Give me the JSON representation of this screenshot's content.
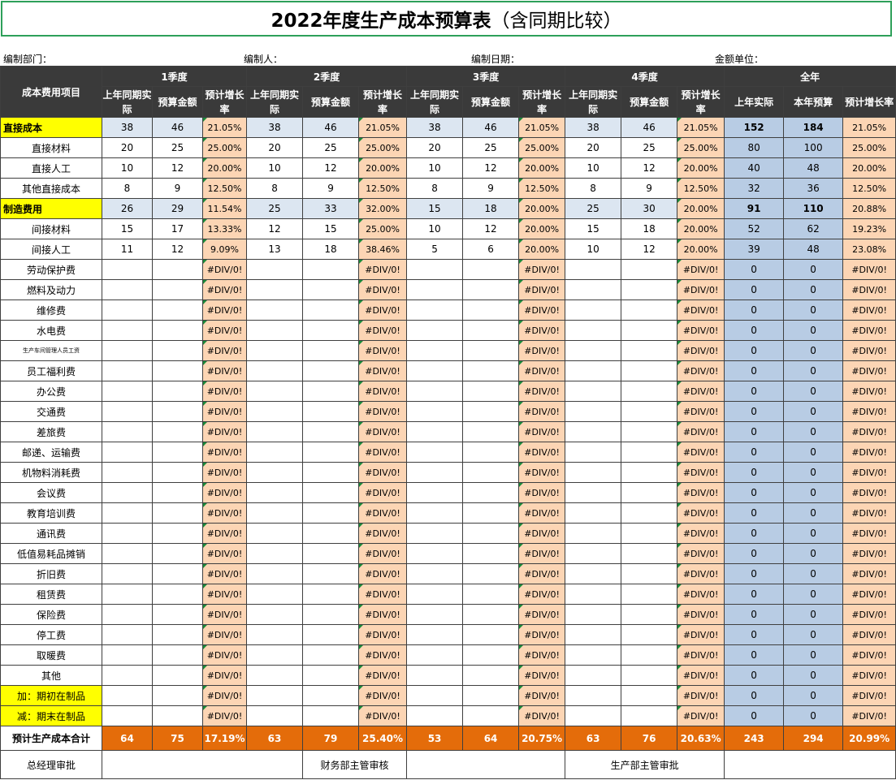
{
  "title": {
    "main": "2022年度生产成本预算表",
    "sub": "（含同期比较）"
  },
  "meta": {
    "dept": "编制部门：",
    "preparer": "编制人：",
    "date": "编制日期：",
    "unit": "金额单位："
  },
  "header": {
    "item": "成本费用项目",
    "quarters": [
      "1季度",
      "2季度",
      "3季度",
      "4季度"
    ],
    "year": "全年",
    "q_cols": [
      "上年同期实际",
      "预算金额",
      "预计增长率"
    ],
    "year_cols": [
      "上年实际",
      "本年预算",
      "预计增长率"
    ]
  },
  "rows": [
    {
      "label": "直接成本",
      "kind": "cat",
      "q": [
        [
          "38",
          "46",
          "21.05%"
        ],
        [
          "38",
          "46",
          "21.05%"
        ],
        [
          "38",
          "46",
          "21.05%"
        ],
        [
          "38",
          "46",
          "21.05%"
        ]
      ],
      "y": [
        "152",
        "184",
        "21.05%"
      ]
    },
    {
      "label": "直接材料",
      "kind": "item",
      "q": [
        [
          "20",
          "25",
          "25.00%"
        ],
        [
          "20",
          "25",
          "25.00%"
        ],
        [
          "20",
          "25",
          "25.00%"
        ],
        [
          "20",
          "25",
          "25.00%"
        ]
      ],
      "y": [
        "80",
        "100",
        "25.00%"
      ]
    },
    {
      "label": "直接人工",
      "kind": "item",
      "q": [
        [
          "10",
          "12",
          "20.00%"
        ],
        [
          "10",
          "12",
          "20.00%"
        ],
        [
          "10",
          "12",
          "20.00%"
        ],
        [
          "10",
          "12",
          "20.00%"
        ]
      ],
      "y": [
        "40",
        "48",
        "20.00%"
      ]
    },
    {
      "label": "其他直接成本",
      "kind": "item",
      "q": [
        [
          "8",
          "9",
          "12.50%"
        ],
        [
          "8",
          "9",
          "12.50%"
        ],
        [
          "8",
          "9",
          "12.50%"
        ],
        [
          "8",
          "9",
          "12.50%"
        ]
      ],
      "y": [
        "32",
        "36",
        "12.50%"
      ]
    },
    {
      "label": "制造费用",
      "kind": "cat",
      "q": [
        [
          "26",
          "29",
          "11.54%"
        ],
        [
          "25",
          "33",
          "32.00%"
        ],
        [
          "15",
          "18",
          "20.00%"
        ],
        [
          "25",
          "30",
          "20.00%"
        ]
      ],
      "y": [
        "91",
        "110",
        "20.88%"
      ]
    },
    {
      "label": "间接材料",
      "kind": "item",
      "q": [
        [
          "15",
          "17",
          "13.33%"
        ],
        [
          "12",
          "15",
          "25.00%"
        ],
        [
          "10",
          "12",
          "20.00%"
        ],
        [
          "15",
          "18",
          "20.00%"
        ]
      ],
      "y": [
        "52",
        "62",
        "19.23%"
      ]
    },
    {
      "label": "间接人工",
      "kind": "item",
      "q": [
        [
          "11",
          "12",
          "9.09%"
        ],
        [
          "13",
          "18",
          "38.46%"
        ],
        [
          "5",
          "6",
          "20.00%"
        ],
        [
          "10",
          "12",
          "20.00%"
        ]
      ],
      "y": [
        "39",
        "48",
        "23.08%"
      ]
    },
    {
      "label": "劳动保护费",
      "kind": "item",
      "q": [
        [
          "",
          "",
          "#DIV/0!"
        ],
        [
          "",
          "",
          "#DIV/0!"
        ],
        [
          "",
          "",
          "#DIV/0!"
        ],
        [
          "",
          "",
          "#DIV/0!"
        ]
      ],
      "y": [
        "0",
        "0",
        "#DIV/0!"
      ]
    },
    {
      "label": "燃料及动力",
      "kind": "item",
      "q": [
        [
          "",
          "",
          "#DIV/0!"
        ],
        [
          "",
          "",
          "#DIV/0!"
        ],
        [
          "",
          "",
          "#DIV/0!"
        ],
        [
          "",
          "",
          "#DIV/0!"
        ]
      ],
      "y": [
        "0",
        "0",
        "#DIV/0!"
      ]
    },
    {
      "label": "维修费",
      "kind": "item",
      "q": [
        [
          "",
          "",
          "#DIV/0!"
        ],
        [
          "",
          "",
          "#DIV/0!"
        ],
        [
          "",
          "",
          "#DIV/0!"
        ],
        [
          "",
          "",
          "#DIV/0!"
        ]
      ],
      "y": [
        "0",
        "0",
        "#DIV/0!"
      ]
    },
    {
      "label": "水电费",
      "kind": "item",
      "q": [
        [
          "",
          "",
          "#DIV/0!"
        ],
        [
          "",
          "",
          "#DIV/0!"
        ],
        [
          "",
          "",
          "#DIV/0!"
        ],
        [
          "",
          "",
          "#DIV/0!"
        ]
      ],
      "y": [
        "0",
        "0",
        "#DIV/0!"
      ]
    },
    {
      "label": "生产车间管理人员工资",
      "kind": "tiny",
      "q": [
        [
          "",
          "",
          "#DIV/0!"
        ],
        [
          "",
          "",
          "#DIV/0!"
        ],
        [
          "",
          "",
          "#DIV/0!"
        ],
        [
          "",
          "",
          "#DIV/0!"
        ]
      ],
      "y": [
        "0",
        "0",
        "#DIV/0!"
      ]
    },
    {
      "label": "员工福利费",
      "kind": "item",
      "q": [
        [
          "",
          "",
          "#DIV/0!"
        ],
        [
          "",
          "",
          "#DIV/0!"
        ],
        [
          "",
          "",
          "#DIV/0!"
        ],
        [
          "",
          "",
          "#DIV/0!"
        ]
      ],
      "y": [
        "0",
        "0",
        "#DIV/0!"
      ]
    },
    {
      "label": "办公费",
      "kind": "item",
      "q": [
        [
          "",
          "",
          "#DIV/0!"
        ],
        [
          "",
          "",
          "#DIV/0!"
        ],
        [
          "",
          "",
          "#DIV/0!"
        ],
        [
          "",
          "",
          "#DIV/0!"
        ]
      ],
      "y": [
        "0",
        "0",
        "#DIV/0!"
      ]
    },
    {
      "label": "交通费",
      "kind": "item",
      "q": [
        [
          "",
          "",
          "#DIV/0!"
        ],
        [
          "",
          "",
          "#DIV/0!"
        ],
        [
          "",
          "",
          "#DIV/0!"
        ],
        [
          "",
          "",
          "#DIV/0!"
        ]
      ],
      "y": [
        "0",
        "0",
        "#DIV/0!"
      ]
    },
    {
      "label": "差旅费",
      "kind": "item",
      "q": [
        [
          "",
          "",
          "#DIV/0!"
        ],
        [
          "",
          "",
          "#DIV/0!"
        ],
        [
          "",
          "",
          "#DIV/0!"
        ],
        [
          "",
          "",
          "#DIV/0!"
        ]
      ],
      "y": [
        "0",
        "0",
        "#DIV/0!"
      ]
    },
    {
      "label": "邮递、运输费",
      "kind": "item",
      "q": [
        [
          "",
          "",
          "#DIV/0!"
        ],
        [
          "",
          "",
          "#DIV/0!"
        ],
        [
          "",
          "",
          "#DIV/0!"
        ],
        [
          "",
          "",
          "#DIV/0!"
        ]
      ],
      "y": [
        "0",
        "0",
        "#DIV/0!"
      ]
    },
    {
      "label": "机物料消耗费",
      "kind": "item",
      "q": [
        [
          "",
          "",
          "#DIV/0!"
        ],
        [
          "",
          "",
          "#DIV/0!"
        ],
        [
          "",
          "",
          "#DIV/0!"
        ],
        [
          "",
          "",
          "#DIV/0!"
        ]
      ],
      "y": [
        "0",
        "0",
        "#DIV/0!"
      ]
    },
    {
      "label": "会议费",
      "kind": "item",
      "q": [
        [
          "",
          "",
          "#DIV/0!"
        ],
        [
          "",
          "",
          "#DIV/0!"
        ],
        [
          "",
          "",
          "#DIV/0!"
        ],
        [
          "",
          "",
          "#DIV/0!"
        ]
      ],
      "y": [
        "0",
        "0",
        "#DIV/0!"
      ]
    },
    {
      "label": "教育培训费",
      "kind": "item",
      "q": [
        [
          "",
          "",
          "#DIV/0!"
        ],
        [
          "",
          "",
          "#DIV/0!"
        ],
        [
          "",
          "",
          "#DIV/0!"
        ],
        [
          "",
          "",
          "#DIV/0!"
        ]
      ],
      "y": [
        "0",
        "0",
        "#DIV/0!"
      ]
    },
    {
      "label": "通讯费",
      "kind": "item",
      "q": [
        [
          "",
          "",
          "#DIV/0!"
        ],
        [
          "",
          "",
          "#DIV/0!"
        ],
        [
          "",
          "",
          "#DIV/0!"
        ],
        [
          "",
          "",
          "#DIV/0!"
        ]
      ],
      "y": [
        "0",
        "0",
        "#DIV/0!"
      ]
    },
    {
      "label": "低值易耗品摊销",
      "kind": "item",
      "q": [
        [
          "",
          "",
          "#DIV/0!"
        ],
        [
          "",
          "",
          "#DIV/0!"
        ],
        [
          "",
          "",
          "#DIV/0!"
        ],
        [
          "",
          "",
          "#DIV/0!"
        ]
      ],
      "y": [
        "0",
        "0",
        "#DIV/0!"
      ]
    },
    {
      "label": "折旧费",
      "kind": "item",
      "q": [
        [
          "",
          "",
          "#DIV/0!"
        ],
        [
          "",
          "",
          "#DIV/0!"
        ],
        [
          "",
          "",
          "#DIV/0!"
        ],
        [
          "",
          "",
          "#DIV/0!"
        ]
      ],
      "y": [
        "0",
        "0",
        "#DIV/0!"
      ]
    },
    {
      "label": "租赁费",
      "kind": "item",
      "q": [
        [
          "",
          "",
          "#DIV/0!"
        ],
        [
          "",
          "",
          "#DIV/0!"
        ],
        [
          "",
          "",
          "#DIV/0!"
        ],
        [
          "",
          "",
          "#DIV/0!"
        ]
      ],
      "y": [
        "0",
        "0",
        "#DIV/0!"
      ]
    },
    {
      "label": "保险费",
      "kind": "item",
      "q": [
        [
          "",
          "",
          "#DIV/0!"
        ],
        [
          "",
          "",
          "#DIV/0!"
        ],
        [
          "",
          "",
          "#DIV/0!"
        ],
        [
          "",
          "",
          "#DIV/0!"
        ]
      ],
      "y": [
        "0",
        "0",
        "#DIV/0!"
      ]
    },
    {
      "label": "停工费",
      "kind": "item",
      "q": [
        [
          "",
          "",
          "#DIV/0!"
        ],
        [
          "",
          "",
          "#DIV/0!"
        ],
        [
          "",
          "",
          "#DIV/0!"
        ],
        [
          "",
          "",
          "#DIV/0!"
        ]
      ],
      "y": [
        "0",
        "0",
        "#DIV/0!"
      ]
    },
    {
      "label": "取暖费",
      "kind": "item",
      "q": [
        [
          "",
          "",
          "#DIV/0!"
        ],
        [
          "",
          "",
          "#DIV/0!"
        ],
        [
          "",
          "",
          "#DIV/0!"
        ],
        [
          "",
          "",
          "#DIV/0!"
        ]
      ],
      "y": [
        "0",
        "0",
        "#DIV/0!"
      ]
    },
    {
      "label": "其他",
      "kind": "item",
      "q": [
        [
          "",
          "",
          "#DIV/0!"
        ],
        [
          "",
          "",
          "#DIV/0!"
        ],
        [
          "",
          "",
          "#DIV/0!"
        ],
        [
          "",
          "",
          "#DIV/0!"
        ]
      ],
      "y": [
        "0",
        "0",
        "#DIV/0!"
      ]
    },
    {
      "label": "加：期初在制品",
      "kind": "sub",
      "q": [
        [
          "",
          "",
          "#DIV/0!"
        ],
        [
          "",
          "",
          "#DIV/0!"
        ],
        [
          "",
          "",
          "#DIV/0!"
        ],
        [
          "",
          "",
          "#DIV/0!"
        ]
      ],
      "y": [
        "0",
        "0",
        "#DIV/0!"
      ]
    },
    {
      "label": "减：期末在制品",
      "kind": "sub",
      "q": [
        [
          "",
          "",
          "#DIV/0!"
        ],
        [
          "",
          "",
          "#DIV/0!"
        ],
        [
          "",
          "",
          "#DIV/0!"
        ],
        [
          "",
          "",
          "#DIV/0!"
        ]
      ],
      "y": [
        "0",
        "0",
        "#DIV/0!"
      ]
    }
  ],
  "total": {
    "label": "预计生产成本合计",
    "q": [
      [
        "64",
        "75",
        "17.19%"
      ],
      [
        "63",
        "79",
        "25.40%"
      ],
      [
        "53",
        "64",
        "20.75%"
      ],
      [
        "63",
        "76",
        "20.63%"
      ]
    ],
    "y": [
      "243",
      "294",
      "20.99%"
    ]
  },
  "signoff": {
    "gm": "总经理审批",
    "finance": "财务部主管审核",
    "production": "生产部主管审批"
  }
}
